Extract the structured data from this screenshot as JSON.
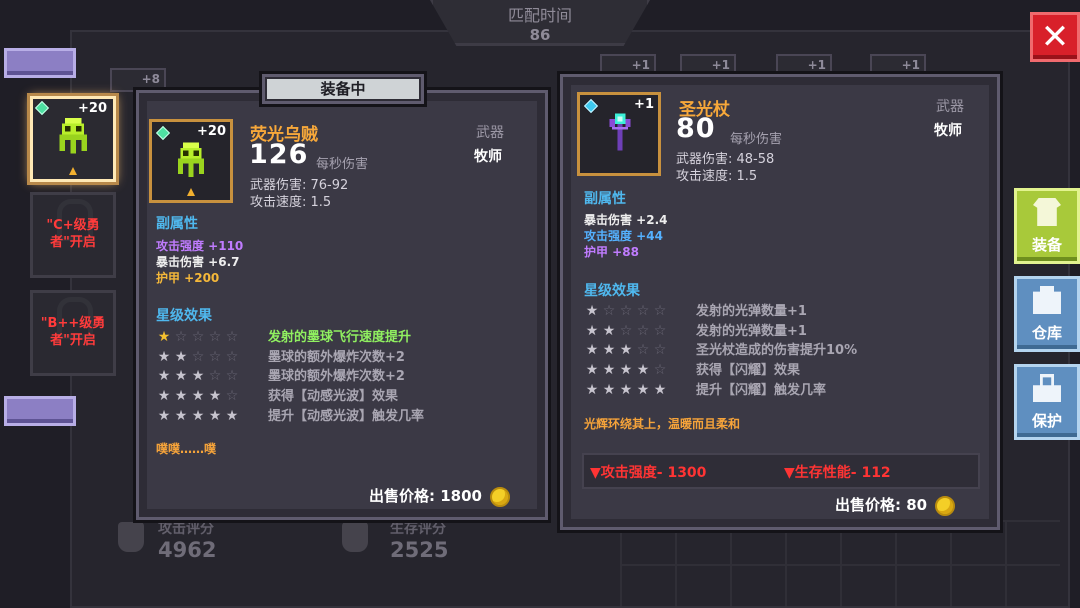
{
  "top": {
    "match_time_label": "匹配时间",
    "match_time_value": "86"
  },
  "close_icon": "close-icon",
  "background": {
    "slot_badges": [
      "+8",
      "+1",
      "+1",
      "+1",
      "+1"
    ]
  },
  "heroes": [
    {
      "plus": "+20",
      "locked_text": ""
    },
    {
      "plus": "",
      "locked_text": "\"C+级勇者\"开启"
    },
    {
      "plus": "",
      "locked_text": "\"B++级勇者\"开启"
    }
  ],
  "equipped": {
    "tag": "装备中",
    "plus": "+20",
    "name": "荧光乌贼",
    "dps": "126",
    "dps_label": "每秒伤害",
    "weapon_damage": "武器伤害: 76-92",
    "attack_speed": "攻击速度: 1.5",
    "type": "武器",
    "class": "牧师",
    "sub_title": "副属性",
    "sub_attrs": [
      {
        "label": "攻击强度 +110",
        "color": "#c07cff"
      },
      {
        "label": "暴击伤害 +6.7",
        "color": "#eeeeee"
      },
      {
        "label": "护甲 +200",
        "color": "#f5b83a"
      }
    ],
    "star_title": "星级效果",
    "star_effects": [
      {
        "text": "发射的墨球飞行速度提升",
        "stars": 1,
        "active": true
      },
      {
        "text": "墨球的额外爆炸次数+2",
        "stars": 2,
        "active": false
      },
      {
        "text": "墨球的额外爆炸次数+2",
        "stars": 3,
        "active": false
      },
      {
        "text": "获得【动感光波】效果",
        "stars": 4,
        "active": false
      },
      {
        "text": "提升【动感光波】触发几率",
        "stars": 5,
        "active": false
      }
    ],
    "flavor": "噗噗……噗",
    "price": "出售价格: 1800"
  },
  "compare": {
    "plus": "+1",
    "name": "圣光杖",
    "dps": "80",
    "dps_label": "每秒伤害",
    "weapon_damage": "武器伤害: 48-58",
    "attack_speed": "攻击速度: 1.5",
    "type": "武器",
    "class": "牧师",
    "sub_title": "副属性",
    "sub_attrs": [
      {
        "label": "暴击伤害 +2.4",
        "color": "#eeeeee"
      },
      {
        "label": "攻击强度 +44",
        "color": "#54b1ff"
      },
      {
        "label": "护甲 +88",
        "color": "#c07cff"
      }
    ],
    "star_title": "星级效果",
    "star_effects": [
      {
        "text": "发射的光弹数量+1",
        "stars": 1,
        "active": false
      },
      {
        "text": "发射的光弹数量+1",
        "stars": 2,
        "active": false
      },
      {
        "text": "圣光杖造成的伤害提升10%",
        "stars": 3,
        "active": false
      },
      {
        "text": "获得【闪耀】效果",
        "stars": 4,
        "active": false
      },
      {
        "text": "提升【闪耀】触发几率",
        "stars": 5,
        "active": false
      }
    ],
    "flavor": "光辉环绕其上，温暖而且柔和",
    "deltas": {
      "attack": "▼攻击强度- 1300",
      "survival": "▼生存性能- 112"
    },
    "price": "出售价格: 80"
  },
  "scores": {
    "attack_label": "攻击评分",
    "attack_value": "4962",
    "survival_label": "生存评分",
    "survival_value": "2525"
  },
  "side_buttons": {
    "equip": "装备",
    "storage": "仓库",
    "protect": "保护"
  }
}
